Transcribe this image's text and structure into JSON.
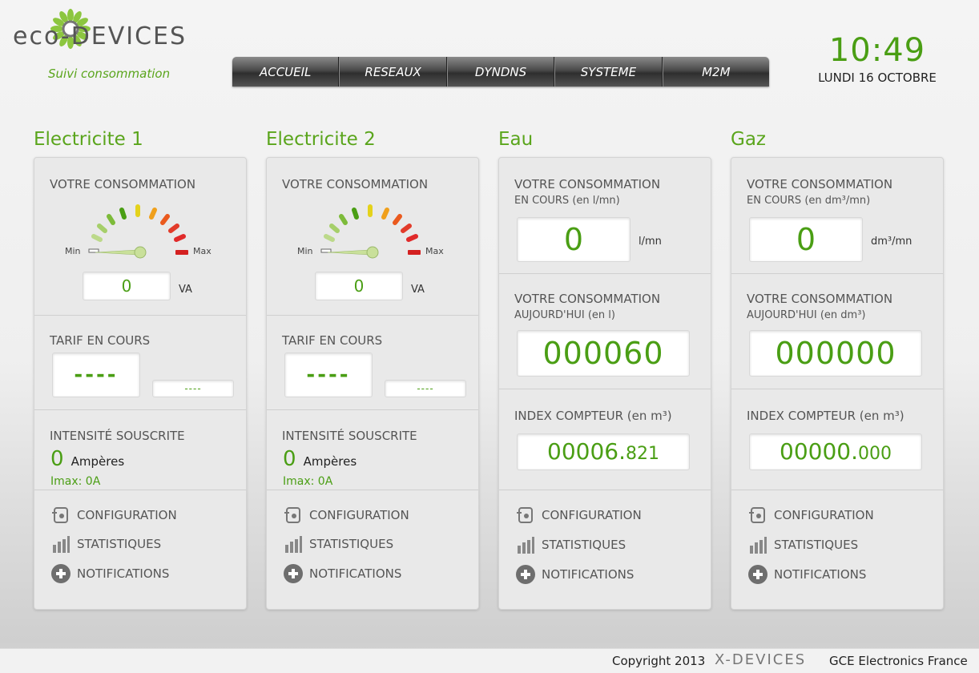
{
  "header": {
    "logo_text": "eco-DEVICES",
    "tagline": "Suivi consommation",
    "nav": [
      "ACCUEIL",
      "RESEAUX",
      "DYNDNS",
      "SYSTEME",
      "M2M"
    ],
    "time": "10:49",
    "date": "LUNDI 16 OCTOBRE"
  },
  "elec1": {
    "title": "Electricite 1",
    "conso_label": "VOTRE CONSOMMATION",
    "gauge_min": "Min",
    "gauge_max": "Max",
    "value": "0",
    "unit": "VA",
    "tarif_label": "TARIF EN COURS",
    "tarif_value": "----",
    "tarif_small": "----",
    "intensite_label": "INTENSITÉ SOUSCRITE",
    "intensite_value": "0",
    "intensite_unit": "Ampères",
    "imax": "Imax: 0A"
  },
  "elec2": {
    "title": "Electricite 2",
    "conso_label": "VOTRE CONSOMMATION",
    "gauge_min": "Min",
    "gauge_max": "Max",
    "value": "0",
    "unit": "VA",
    "tarif_label": "TARIF EN COURS",
    "tarif_value": "----",
    "tarif_small": "----",
    "intensite_label": "INTENSITÉ SOUSCRITE",
    "intensite_value": "0",
    "intensite_unit": "Ampères",
    "imax": "Imax: 0A"
  },
  "eau": {
    "title": "Eau",
    "conso_label": "VOTRE CONSOMMATION",
    "conso_sub": "EN COURS (en l/mn)",
    "current_value": "0",
    "current_unit": "l/mn",
    "today_label": "VOTRE CONSOMMATION",
    "today_sub": "AUJOURD'HUI (en l)",
    "today_value": "000060",
    "index_label": "INDEX COMPTEUR (en m³)",
    "index_int": "00006.",
    "index_dec": "821"
  },
  "gaz": {
    "title": "Gaz",
    "conso_label": "VOTRE CONSOMMATION",
    "conso_sub": "EN COURS (en dm³/mn)",
    "current_value": "0",
    "current_unit": "dm³/mn",
    "today_label": "VOTRE CONSOMMATION",
    "today_sub": "AUJOURD'HUI (en dm³)",
    "today_value": "000000",
    "index_label": "INDEX COMPTEUR (en m³)",
    "index_int": "00000.",
    "index_dec": "000"
  },
  "links": {
    "configuration": "CONFIGURATION",
    "statistiques": "STATISTIQUES",
    "notifications": "NOTIFICATIONS"
  },
  "footer": {
    "copyright": "Copyright 2013",
    "brand": "X-DEVICES",
    "company": "GCE Electronics France"
  },
  "colors": {
    "accent_green": "#5aa51c",
    "value_green": "#4a9e14",
    "nav_dark": "#2e2e2e"
  },
  "icons": [
    "logo-flower-icon",
    "configuration-icon",
    "statistics-icon",
    "notifications-plus-icon",
    "gauge-icon"
  ]
}
